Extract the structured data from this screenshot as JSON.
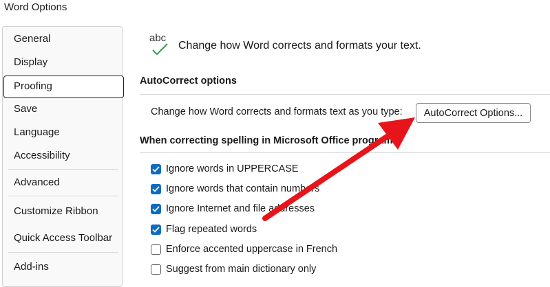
{
  "window": {
    "title": "Word Options"
  },
  "sidebar": {
    "items": [
      {
        "label": "General"
      },
      {
        "label": "Display"
      },
      {
        "label": "Proofing",
        "selected": true
      },
      {
        "label": "Save"
      },
      {
        "label": "Language"
      },
      {
        "label": "Accessibility"
      },
      {
        "label": "Advanced"
      },
      {
        "label": "Customize Ribbon"
      },
      {
        "label": "Quick Access Toolbar"
      },
      {
        "label": "Add-ins"
      }
    ]
  },
  "header": {
    "icon_text": "abc",
    "icon": "checkmark-icon",
    "text": "Change how Word corrects and formats your text."
  },
  "autocorrect": {
    "title": "AutoCorrect options",
    "prompt": "Change how Word corrects and formats text as you type:",
    "button_label": "AutoCorrect Options..."
  },
  "spelling": {
    "title": "When correcting spelling in Microsoft Office programs",
    "options": [
      {
        "label": "Ignore words in UPPERCASE",
        "checked": true
      },
      {
        "label": "Ignore words that contain numbers",
        "checked": true
      },
      {
        "label": "Ignore Internet and file addresses",
        "checked": true
      },
      {
        "label": "Flag repeated words",
        "checked": true
      },
      {
        "label": "Enforce accented uppercase in French",
        "checked": false
      },
      {
        "label": "Suggest from main dictionary only",
        "checked": false
      }
    ]
  },
  "colors": {
    "accent": "#0f6cbd",
    "annotation_arrow": "#e8141b",
    "icon_check": "#2e9e4f"
  }
}
